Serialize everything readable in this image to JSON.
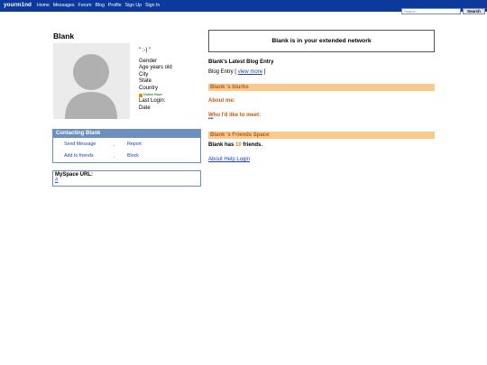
{
  "nav": {
    "brand": "yourm1nd",
    "links": [
      "Home",
      "Messages",
      "Forum",
      "Blog",
      "Profile",
      "Sign Up",
      "Sign In"
    ],
    "search_placeholder": "Search...",
    "search_button": "Search"
  },
  "profile": {
    "name": "Blank",
    "mood": "\" :-) \"",
    "gender": "Gender",
    "age": "Age years old",
    "city": "City",
    "state": "State",
    "country": "Country",
    "online": "Online Now!",
    "last_login_label": "Last Login:",
    "last_login_value": "Date"
  },
  "contact": {
    "title": "Contacting Blank",
    "send_message": "Send Message",
    "report": "Report",
    "add_friends": "Add to friends",
    "block": "Block",
    "separator": "."
  },
  "myspace": {
    "label": "MySpace URL:",
    "link": "#"
  },
  "right": {
    "network": "Blank is in your extended network",
    "blog_heading": "Blank's Latest Blog Entry",
    "blog_entry_prefix": "Blog Entry [ ",
    "blog_view_more": "view more",
    "blog_entry_suffix": " ]",
    "blurbs_title": "Blank 's blurbs",
    "about_me": "About me:",
    "who_like": "Who I'd like to meet:",
    "who_like_value": "\"\"",
    "friends_space_title": "Blank 's Friends Space",
    "friends_prefix": "Blank has ",
    "friends_count": "10",
    "friends_suffix": " friends.",
    "help_link": "About Help Login"
  },
  "colors": {
    "nav_bg": "#0b3a9c",
    "box_border": "#6b8fbe",
    "orange_bar": "#f9c98e",
    "orange_text": "#c05a10",
    "link": "#1a3fb8"
  }
}
